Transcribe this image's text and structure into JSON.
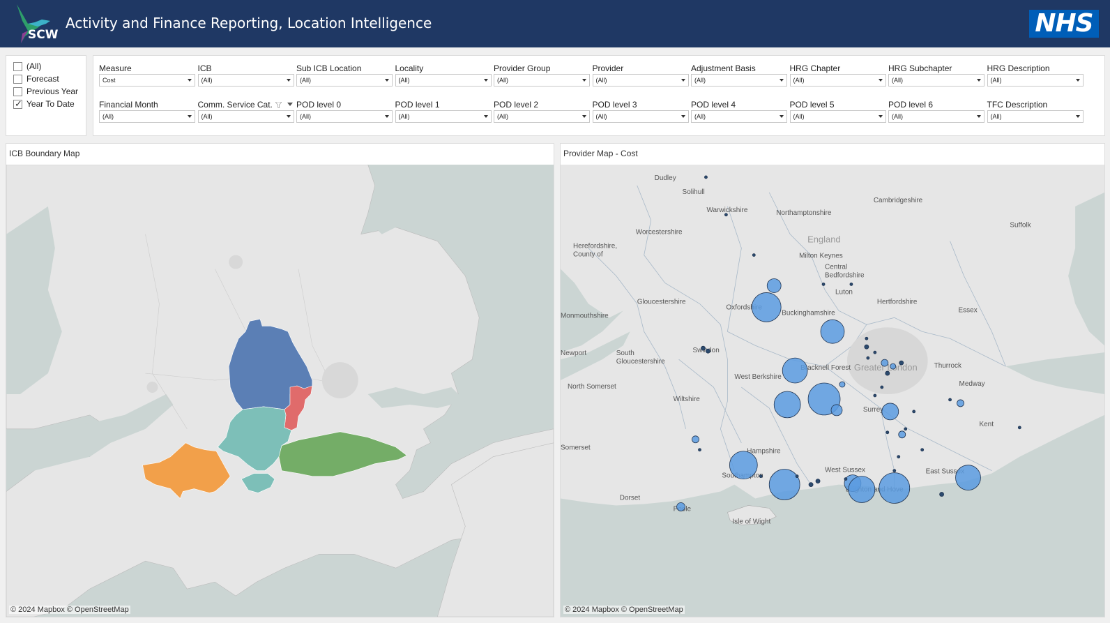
{
  "header": {
    "title": "Activity and Finance Reporting, Location Intelligence",
    "scw_logo_text": "SCW",
    "nhs_logo_text": "NHS"
  },
  "period_filter": {
    "items": [
      {
        "label": "(All)",
        "checked": false
      },
      {
        "label": "Forecast",
        "checked": false
      },
      {
        "label": "Previous Year",
        "checked": false
      },
      {
        "label": "Year To Date",
        "checked": true
      }
    ]
  },
  "filters": {
    "row1": [
      {
        "label": "Measure",
        "value": "Cost"
      },
      {
        "label": "ICB",
        "value": "(All)"
      },
      {
        "label": "Sub ICB Location",
        "value": "(All)"
      },
      {
        "label": "Locality",
        "value": "(All)"
      },
      {
        "label": "Provider Group",
        "value": "(All)"
      },
      {
        "label": "Provider",
        "value": "(All)"
      },
      {
        "label": "Adjustment Basis",
        "value": "(All)"
      },
      {
        "label": "HRG Chapter",
        "value": "(All)"
      },
      {
        "label": "HRG Subchapter",
        "value": "(All)"
      },
      {
        "label": "HRG Description",
        "value": "(All)"
      }
    ],
    "row2": [
      {
        "label": "Financial Month",
        "value": "(All)"
      },
      {
        "label": "Comm. Service Cat.",
        "value": "(All)"
      },
      {
        "label": "POD level 0",
        "value": "(All)"
      },
      {
        "label": "POD level 1",
        "value": "(All)"
      },
      {
        "label": "POD level 2",
        "value": "(All)"
      },
      {
        "label": "POD level 3",
        "value": "(All)"
      },
      {
        "label": "POD level 4",
        "value": "(All)"
      },
      {
        "label": "POD level 5",
        "value": "(All)"
      },
      {
        "label": "POD level 6",
        "value": "(All)"
      },
      {
        "label": "TFC Description",
        "value": "(All)"
      }
    ]
  },
  "icb_map": {
    "title": "ICB Boundary Map",
    "attribution": "© 2024 Mapbox  © OpenStreetMap",
    "region_colors": {
      "blue": "#5b7fb5",
      "red": "#e06b6b",
      "teal": "#7dbfb8",
      "orange": "#f2a04a",
      "green": "#74ad67"
    }
  },
  "provider_map": {
    "title": "Provider Map - Cost",
    "attribution": "© 2024 Mapbox  © OpenStreetMap",
    "bubble_color": "#5b9be0",
    "places": [
      "Dudley",
      "Solihull",
      "Warwickshire",
      "Northamptonshire",
      "Cambridgeshire",
      "Worcestershire",
      "England",
      "Herefordshire, County of",
      "Milton Keynes",
      "Central Bedfordshire",
      "Suffolk",
      "Luton",
      "Gloucestershire",
      "Oxfordshire",
      "Hertfordshire",
      "Buckinghamshire",
      "Essex",
      "Monmouthshire",
      "Swindon",
      "Newport",
      "South Gloucestershire",
      "Greater London",
      "Thurrock",
      "West Berkshire",
      "Bracknell Forest",
      "North Somerset",
      "Medway",
      "Wiltshire",
      "Surrey",
      "Kent",
      "Somerset",
      "Hampshire",
      "Southampton",
      "West Sussex",
      "East Sussex",
      "Brighton and Hove",
      "Dorset",
      "Poole",
      "Isle of Wight"
    ]
  }
}
